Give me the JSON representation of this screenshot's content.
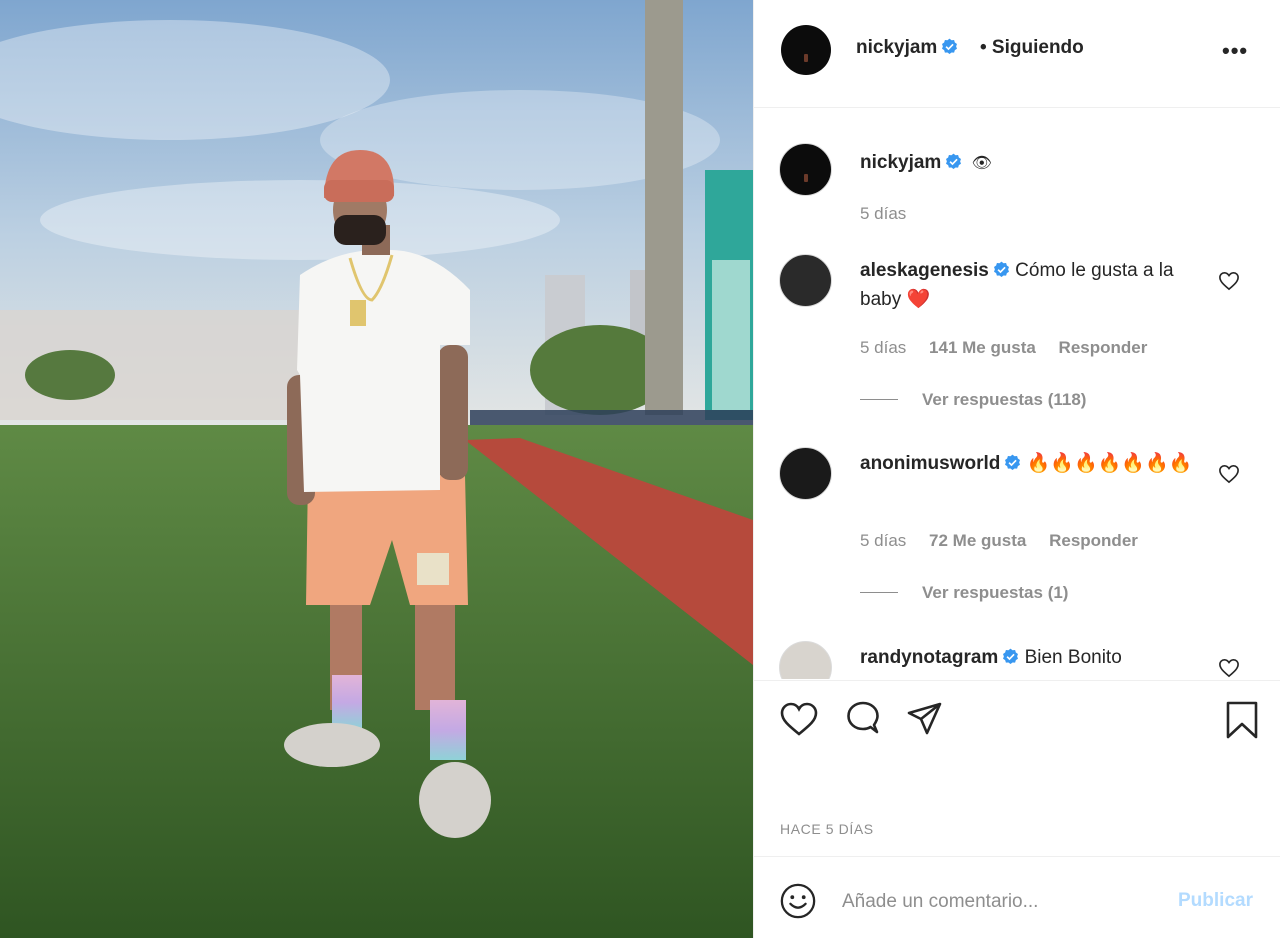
{
  "post": {
    "author": "nickyjam",
    "follow_status": "• Siguiendo",
    "more_icon": "more-options-icon",
    "time_ago": "HACE 5 DÍAS"
  },
  "caption": {
    "username": "nickyjam",
    "emoji": "👁",
    "time": "5 días"
  },
  "comments": [
    {
      "username": "aleskagenesis",
      "text": "Cómo le gusta a la baby ❤️",
      "time": "5 días",
      "likes": "141 Me gusta",
      "reply": "Responder",
      "view_replies": "Ver respuestas (118)"
    },
    {
      "username": "anonimusworld",
      "text": "🔥🔥🔥🔥🔥🔥🔥",
      "time": "5 días",
      "likes": "72 Me gusta",
      "reply": "Responder",
      "view_replies": "Ver respuestas (1)"
    },
    {
      "username": "randynotagram",
      "text": "Bien Bonito"
    }
  ],
  "composer": {
    "placeholder": "Añade un comentario...",
    "publish": "Publicar"
  },
  "colors": {
    "verified": "#3897f0",
    "muted": "#8e8e8e",
    "publish_disabled": "#b3dbff"
  }
}
